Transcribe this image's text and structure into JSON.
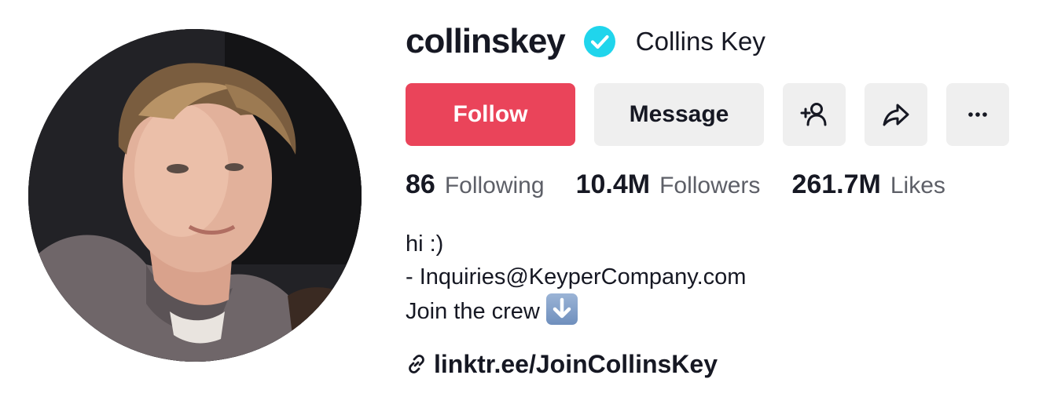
{
  "profile": {
    "username": "collinskey",
    "display_name": "Collins Key",
    "verified": true
  },
  "buttons": {
    "follow": "Follow",
    "message": "Message"
  },
  "icons": {
    "add_friend": "person-plus-icon",
    "share": "share-arrow-icon",
    "more": "more-dots-icon",
    "verified": "verified-check-icon",
    "link": "link-icon",
    "emoji": "down-arrow-emoji-icon"
  },
  "stats": {
    "following_count": "86",
    "following_label": "Following",
    "followers_count": "10.4M",
    "followers_label": "Followers",
    "likes_count": "261.7M",
    "likes_label": "Likes"
  },
  "bio": {
    "line1": "hi :)",
    "line2": "- Inquiries@KeyperCompany.com",
    "line3": "Join the crew"
  },
  "link": {
    "text": "linktr.ee/JoinCollinsKey"
  },
  "colors": {
    "follow_bg": "#ea445a",
    "button_bg": "#efefef",
    "verified": "#20d5ec",
    "text": "#161823",
    "muted": "#5d5f67"
  }
}
